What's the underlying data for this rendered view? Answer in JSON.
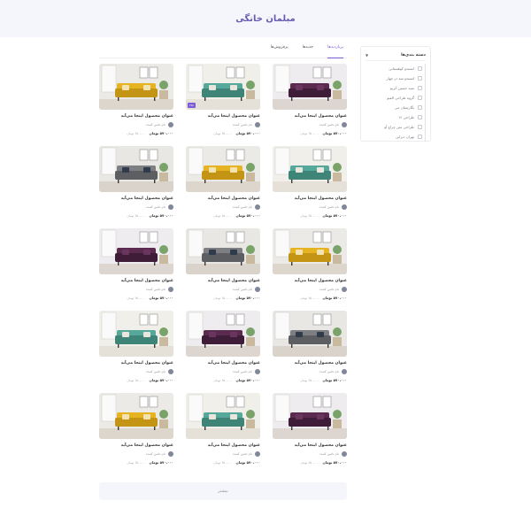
{
  "header": {
    "title": "مبلمان خانگی"
  },
  "tabs": [
    {
      "label": "پربازدیدها",
      "active": true
    },
    {
      "label": "جدیدها",
      "active": false
    },
    {
      "label": "پرفروش‌ها",
      "active": false
    }
  ],
  "sidebar": {
    "title": "دسته بندی‌ها",
    "categories": [
      "استندو کوهستانی",
      "استندو سه در چهار",
      "سید حسین آتریو",
      "گروه طراحی الفبو",
      "نگارستان جی",
      "طراحی ۱۲",
      "طراحی متن چراغ آو",
      "تهران دیزاین"
    ]
  },
  "products": [
    {
      "title": "عنوان محصول اینجا می‌آید",
      "seller": "نام تامین کننده",
      "price": "۵۷۰،۰۰۰ تومان",
      "old_price": "۶۵۰،۰۰۰ تومان",
      "image": "purple-sofa",
      "badge": ""
    },
    {
      "title": "عنوان محصول اینجا می‌آید",
      "seller": "نام تامین کننده",
      "price": "۵۷۰،۰۰۰ تومان",
      "old_price": "۶۵۰،۰۰۰ تومان",
      "image": "green-sofa",
      "badge": "۲۵٪"
    },
    {
      "title": "عنوان محصول اینجا می‌آید",
      "seller": "نام تامین کننده",
      "price": "۵۷۰،۰۰۰ تومان",
      "old_price": "۶۵۰،۰۰۰ تومان",
      "image": "yellow-sofa",
      "badge": ""
    },
    {
      "title": "عنوان محصول اینجا می‌آید",
      "seller": "نام تامین کننده",
      "price": "۵۷۰،۰۰۰ تومان",
      "old_price": "۶۵۰،۰۰۰ تومان",
      "image": "green-sofa",
      "badge": ""
    },
    {
      "title": "عنوان محصول اینجا می‌آید",
      "seller": "نام تامین کننده",
      "price": "۵۷۰،۰۰۰ تومان",
      "old_price": "۶۵۰،۰۰۰ تومان",
      "image": "yellow-sofa",
      "badge": ""
    },
    {
      "title": "عنوان محصول اینجا می‌آید",
      "seller": "نام تامین کننده",
      "price": "۵۷۰،۰۰۰ تومان",
      "old_price": "۶۵۰،۰۰۰ تومان",
      "image": "grey-sofa",
      "badge": ""
    },
    {
      "title": "عنوان محصول اینجا می‌آید",
      "seller": "نام تامین کننده",
      "price": "۵۷۰،۰۰۰ تومان",
      "old_price": "۶۵۰،۰۰۰ تومان",
      "image": "yellow-sofa",
      "badge": ""
    },
    {
      "title": "عنوان محصول اینجا می‌آید",
      "seller": "نام تامین کننده",
      "price": "۵۷۰،۰۰۰ تومان",
      "old_price": "۶۵۰،۰۰۰ تومان",
      "image": "grey-sofa",
      "badge": ""
    },
    {
      "title": "عنوان محصول اینجا می‌آید",
      "seller": "نام تامین کننده",
      "price": "۵۷۰،۰۰۰ تومان",
      "old_price": "۶۵۰،۰۰۰ تومان",
      "image": "purple-sofa",
      "badge": ""
    },
    {
      "title": "عنوان محصول اینجا می‌آید",
      "seller": "نام تامین کننده",
      "price": "۵۷۰،۰۰۰ تومان",
      "old_price": "۶۵۰،۰۰۰ تومان",
      "image": "grey-sofa",
      "badge": ""
    },
    {
      "title": "عنوان محصول اینجا می‌آید",
      "seller": "نام تامین کننده",
      "price": "۵۷۰،۰۰۰ تومان",
      "old_price": "۶۵۰،۰۰۰ تومان",
      "image": "purple-sofa",
      "badge": ""
    },
    {
      "title": "عنوان محصول اینجا می‌آید",
      "seller": "نام تامین کننده",
      "price": "۵۷۰،۰۰۰ تومان",
      "old_price": "۶۵۰،۰۰۰ تومان",
      "image": "green-sofa",
      "badge": ""
    },
    {
      "title": "عنوان محصول اینجا می‌آید",
      "seller": "نام تامین کننده",
      "price": "۵۷۰،۰۰۰ تومان",
      "old_price": "۶۵۰،۰۰۰ تومان",
      "image": "purple-sofa",
      "badge": ""
    },
    {
      "title": "عنوان محصول اینجا می‌آید",
      "seller": "نام تامین کننده",
      "price": "۵۷۰،۰۰۰ تومان",
      "old_price": "۶۵۰،۰۰۰ تومان",
      "image": "green-sofa",
      "badge": ""
    },
    {
      "title": "عنوان محصول اینجا می‌آید",
      "seller": "نام تامین کننده",
      "price": "۵۷۰،۰۰۰ تومان",
      "old_price": "۶۵۰،۰۰۰ تومان",
      "image": "yellow-sofa",
      "badge": ""
    }
  ],
  "more_button": {
    "label": "بیشتر"
  },
  "colors": {
    "accent": "#7b5cd6",
    "header_bg": "#f4f6fc",
    "title": "#6a5bb0"
  }
}
